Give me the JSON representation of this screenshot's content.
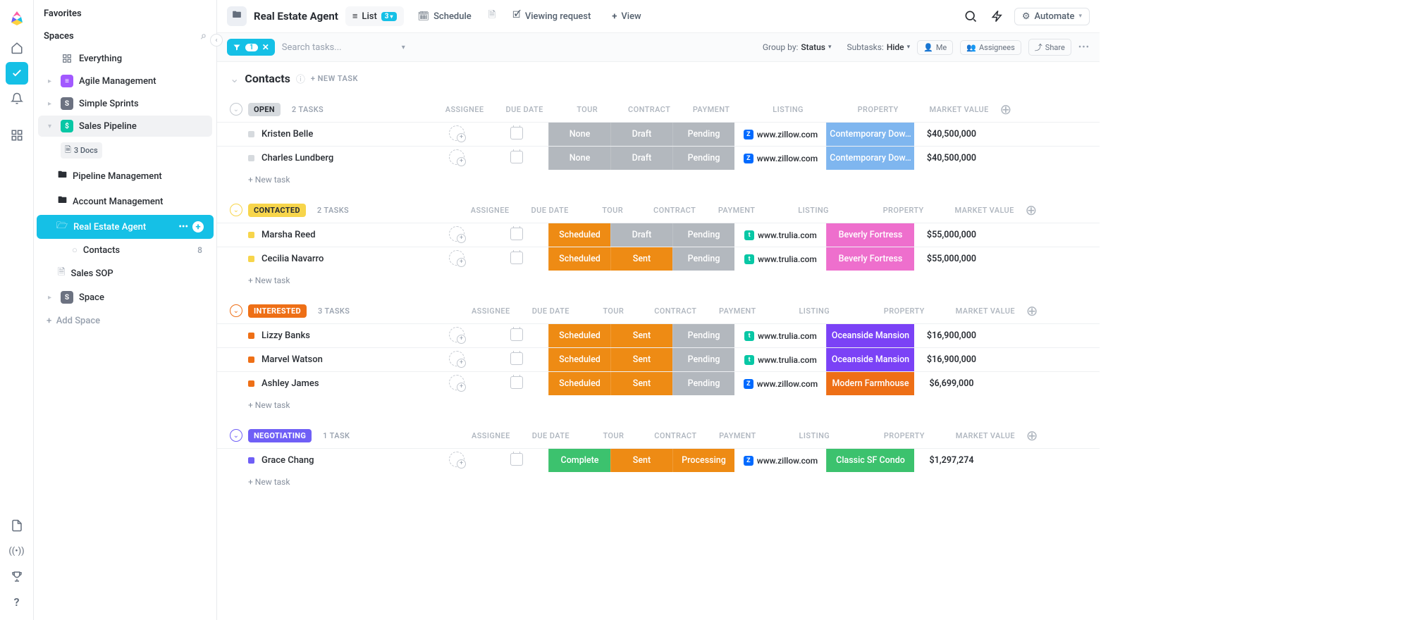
{
  "sidebar": {
    "favorites": "Favorites",
    "spaces": "Spaces",
    "everything": "Everything",
    "agile": "Agile Management",
    "simple": "Simple Sprints",
    "salespipe": "Sales Pipeline",
    "docs3": "3 Docs",
    "pipemgmt": "Pipeline Management",
    "acctmgmt": "Account Management",
    "realestate": "Real Estate Agent",
    "contacts": "Contacts",
    "contacts_count": "8",
    "salessop": "Sales SOP",
    "space": "Space",
    "addspace": "Add Space"
  },
  "topbar": {
    "title": "Real Estate Agent",
    "list": "List",
    "list_badge": "3",
    "schedule": "Schedule",
    "viewing": "Viewing request",
    "addview": "View",
    "automate": "Automate"
  },
  "controls": {
    "filter_count": "1",
    "search_placeholder": "Search tasks...",
    "groupby_label": "Group by:",
    "groupby_value": "Status",
    "subtasks_label": "Subtasks:",
    "subtasks_value": "Hide",
    "me": "Me",
    "assignees": "Assignees",
    "share": "Share"
  },
  "list": {
    "section": "Contacts",
    "newtask_caps": "+ NEW TASK",
    "newtask": "+ New task",
    "cols": {
      "assignee": "ASSIGNEE",
      "due": "DUE DATE",
      "tour": "TOUR",
      "contract": "CONTRACT",
      "payment": "PAYMENT",
      "listing": "LISTING",
      "property": "PROPERTY",
      "value": "MARKET VALUE"
    }
  },
  "groups": [
    {
      "id": "open",
      "label": "OPEN",
      "count": "2 TASKS",
      "chev_class": "c-open",
      "badge_class": "bg-open",
      "sq_color": "#d6dade",
      "rows": [
        {
          "name": "Kristen Belle",
          "tour": {
            "t": "None",
            "c": "bg-gray"
          },
          "contract": {
            "t": "Draft",
            "c": "bg-gray"
          },
          "payment": {
            "t": "Pending",
            "c": "bg-gray"
          },
          "listing": {
            "t": "www.zillow.com",
            "ico": "z"
          },
          "property": {
            "t": "Contemporary Dow…",
            "c": "bg-lblue"
          },
          "value": "$40,500,000"
        },
        {
          "name": "Charles Lundberg",
          "tour": {
            "t": "None",
            "c": "bg-gray"
          },
          "contract": {
            "t": "Draft",
            "c": "bg-gray"
          },
          "payment": {
            "t": "Pending",
            "c": "bg-gray"
          },
          "listing": {
            "t": "www.zillow.com",
            "ico": "z"
          },
          "property": {
            "t": "Contemporary Dow…",
            "c": "bg-lblue"
          },
          "value": "$40,500,000"
        }
      ]
    },
    {
      "id": "contacted",
      "label": "CONTACTED",
      "count": "2 TASKS",
      "chev_class": "c-contacted",
      "badge_class": "bg-contacted",
      "sq_color": "#f7d54b",
      "rows": [
        {
          "name": "Marsha Reed",
          "tour": {
            "t": "Scheduled",
            "c": "bg-orange"
          },
          "contract": {
            "t": "Draft",
            "c": "bg-gray"
          },
          "payment": {
            "t": "Pending",
            "c": "bg-gray"
          },
          "listing": {
            "t": "www.trulia.com",
            "ico": "t"
          },
          "property": {
            "t": "Beverly Fortress",
            "c": "bg-pink"
          },
          "value": "$55,000,000"
        },
        {
          "name": "Cecilia Navarro",
          "tour": {
            "t": "Scheduled",
            "c": "bg-orange"
          },
          "contract": {
            "t": "Sent",
            "c": "bg-orange"
          },
          "payment": {
            "t": "Pending",
            "c": "bg-gray"
          },
          "listing": {
            "t": "www.trulia.com",
            "ico": "t"
          },
          "property": {
            "t": "Beverly Fortress",
            "c": "bg-pink"
          },
          "value": "$55,000,000"
        }
      ]
    },
    {
      "id": "interested",
      "label": "INTERESTED",
      "count": "3 TASKS",
      "chev_class": "c-interested",
      "badge_class": "bg-interested",
      "sq_color": "#ee6f16",
      "rows": [
        {
          "name": "Lizzy Banks",
          "tour": {
            "t": "Scheduled",
            "c": "bg-orange"
          },
          "contract": {
            "t": "Sent",
            "c": "bg-orange"
          },
          "payment": {
            "t": "Pending",
            "c": "bg-gray"
          },
          "listing": {
            "t": "www.trulia.com",
            "ico": "t"
          },
          "property": {
            "t": "Oceanside Mansion",
            "c": "bg-violet"
          },
          "value": "$16,900,000"
        },
        {
          "name": "Marvel Watson",
          "tour": {
            "t": "Scheduled",
            "c": "bg-orange"
          },
          "contract": {
            "t": "Sent",
            "c": "bg-orange"
          },
          "payment": {
            "t": "Pending",
            "c": "bg-gray"
          },
          "listing": {
            "t": "www.trulia.com",
            "ico": "t"
          },
          "property": {
            "t": "Oceanside Mansion",
            "c": "bg-violet"
          },
          "value": "$16,900,000"
        },
        {
          "name": "Ashley James",
          "tour": {
            "t": "Scheduled",
            "c": "bg-orange"
          },
          "contract": {
            "t": "Sent",
            "c": "bg-orange"
          },
          "payment": {
            "t": "Pending",
            "c": "bg-gray"
          },
          "listing": {
            "t": "www.zillow.com",
            "ico": "z"
          },
          "property": {
            "t": "Modern Farmhouse",
            "c": "bg-dorange"
          },
          "value": "$6,699,000"
        }
      ]
    },
    {
      "id": "negotiating",
      "label": "NEGOTIATING",
      "count": "1 TASK",
      "chev_class": "c-negotiating",
      "badge_class": "bg-negotiating",
      "sq_color": "#6f5ff6",
      "rows": [
        {
          "name": "Grace Chang",
          "tour": {
            "t": "Complete",
            "c": "bg-green"
          },
          "contract": {
            "t": "Sent",
            "c": "bg-orange"
          },
          "payment": {
            "t": "Processing",
            "c": "bg-orange"
          },
          "listing": {
            "t": "www.zillow.com",
            "ico": "z"
          },
          "property": {
            "t": "Classic SF Condo",
            "c": "bg-green"
          },
          "value": "$1,297,274"
        }
      ]
    }
  ]
}
